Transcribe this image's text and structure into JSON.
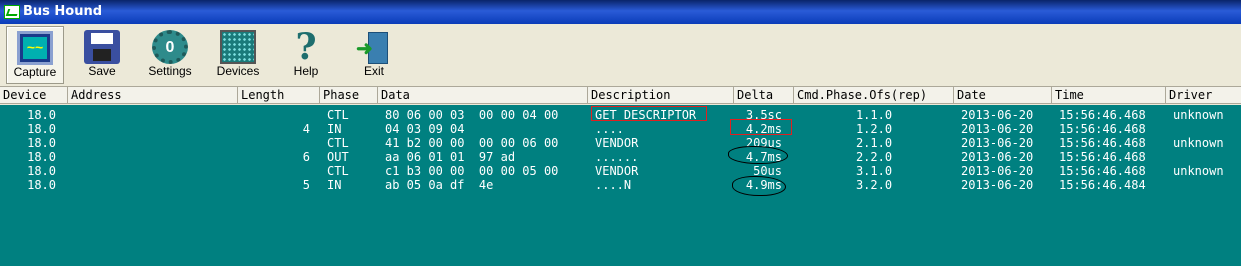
{
  "window": {
    "title": "Bus Hound"
  },
  "toolbar": {
    "buttons": [
      {
        "label": "Capture",
        "icon": "capture-icon"
      },
      {
        "label": "Save",
        "icon": "save-icon"
      },
      {
        "label": "Settings",
        "icon": "settings-icon"
      },
      {
        "label": "Devices",
        "icon": "devices-icon"
      },
      {
        "label": "Help",
        "icon": "help-icon"
      },
      {
        "label": "Exit",
        "icon": "exit-icon"
      }
    ]
  },
  "table": {
    "columns": [
      "Device",
      "Address",
      "Length",
      "Phase",
      "Data",
      "Description",
      "Delta",
      "Cmd.Phase.Ofs(rep)",
      "Date",
      "Time",
      "Driver"
    ],
    "rows": [
      {
        "device": "18.0",
        "address": "",
        "length": "",
        "phase": "CTL",
        "data": "80 06 00 03  00 00 04 00",
        "description": "GET DESCRIPTOR",
        "delta": "3.5sc",
        "cmd": "1.1.0",
        "date": "2013-06-20",
        "time": "15:56:46.468",
        "driver": "unknown"
      },
      {
        "device": "18.0",
        "address": "",
        "length": "4",
        "phase": "IN",
        "data": "04 03 09 04",
        "description": "....",
        "delta": "4.2ms",
        "cmd": "1.2.0",
        "date": "2013-06-20",
        "time": "15:56:46.468",
        "driver": ""
      },
      {
        "device": "18.0",
        "address": "",
        "length": "",
        "phase": "CTL",
        "data": "41 b2 00 00  00 00 06 00",
        "description": "VENDOR",
        "delta": "209us",
        "cmd": "2.1.0",
        "date": "2013-06-20",
        "time": "15:56:46.468",
        "driver": "unknown"
      },
      {
        "device": "18.0",
        "address": "",
        "length": "6",
        "phase": "OUT",
        "data": "aa 06 01 01  97 ad",
        "description": "......",
        "delta": "4.7ms",
        "cmd": "2.2.0",
        "date": "2013-06-20",
        "time": "15:56:46.468",
        "driver": ""
      },
      {
        "device": "18.0",
        "address": "",
        "length": "",
        "phase": "CTL",
        "data": "c1 b3 00 00  00 00 05 00",
        "description": "VENDOR",
        "delta": "50us",
        "cmd": "3.1.0",
        "date": "2013-06-20",
        "time": "15:56:46.468",
        "driver": "unknown"
      },
      {
        "device": "18.0",
        "address": "",
        "length": "5",
        "phase": "IN",
        "data": "ab 05 0a df  4e",
        "description": "....N",
        "delta": "4.9ms",
        "cmd": "3.2.0",
        "date": "2013-06-20",
        "time": "15:56:46.484",
        "driver": ""
      }
    ]
  },
  "colors": {
    "background": "#008080",
    "toolbar": "#ece9d8",
    "annotation_red": "#e02020",
    "annotation_black": "#000000"
  }
}
